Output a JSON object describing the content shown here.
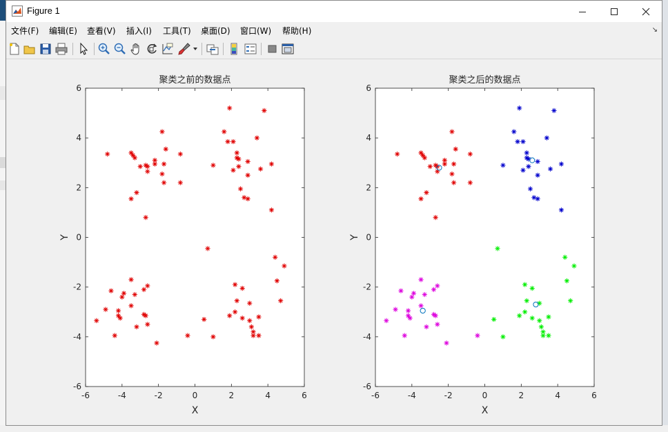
{
  "window": {
    "title": "Figure 1"
  },
  "menu": {
    "items": [
      "文件(F)",
      "编辑(E)",
      "查看(V)",
      "插入(I)",
      "工具(T)",
      "桌面(D)",
      "窗口(W)",
      "帮助(H)"
    ]
  },
  "toolbar": {
    "icons": [
      "new-figure-icon",
      "open-file-icon",
      "save-icon",
      "print-icon",
      "pointer-icon",
      "zoom-in-icon",
      "zoom-out-icon",
      "pan-icon",
      "rotate-3d-icon",
      "data-cursor-icon",
      "brush-icon",
      "link-plot-icon",
      "colorbar-icon",
      "legend-icon",
      "hide-plot-tools-icon",
      "show-plot-tools-icon"
    ]
  },
  "colors": {
    "red": "#e00000",
    "blue": "#0000cc",
    "magenta": "#dd00dd",
    "green": "#00ee00",
    "center": "#0072bd"
  },
  "chart_data": [
    {
      "type": "scatter",
      "title": "聚类之前的数据点",
      "xlabel": "X",
      "ylabel": "Y",
      "xlim": [
        -6,
        6
      ],
      "ylim": [
        -6,
        6
      ],
      "xticks": [
        -6,
        -4,
        -2,
        0,
        2,
        4,
        6
      ],
      "yticks": [
        -6,
        -4,
        -2,
        0,
        2,
        4,
        6
      ],
      "grid": false,
      "series": [
        {
          "marker": "asterisk",
          "color": "#e00000",
          "points": [
            [
              -4.8,
              3.35
            ],
            [
              -3.5,
              3.4
            ],
            [
              -3.3,
              3.2
            ],
            [
              -3.4,
              3.3
            ],
            [
              -3.0,
              2.85
            ],
            [
              -2.7,
              2.9
            ],
            [
              -2.6,
              2.85
            ],
            [
              -2.6,
              2.65
            ],
            [
              -2.2,
              2.95
            ],
            [
              -2.2,
              3.1
            ],
            [
              -1.8,
              2.55
            ],
            [
              -1.7,
              2.95
            ],
            [
              -1.7,
              2.2
            ],
            [
              -1.6,
              3.55
            ],
            [
              -1.8,
              4.25
            ],
            [
              -0.8,
              3.35
            ],
            [
              -0.8,
              2.2
            ],
            [
              -3.5,
              1.55
            ],
            [
              -3.2,
              1.8
            ],
            [
              -2.7,
              0.8
            ],
            [
              1.9,
              5.2
            ],
            [
              3.8,
              5.1
            ],
            [
              1.6,
              4.25
            ],
            [
              1.8,
              3.85
            ],
            [
              2.1,
              3.85
            ],
            [
              3.4,
              4.0
            ],
            [
              2.3,
              3.4
            ],
            [
              2.3,
              3.2
            ],
            [
              2.4,
              3.15
            ],
            [
              1.0,
              2.9
            ],
            [
              2.1,
              2.7
            ],
            [
              2.4,
              2.85
            ],
            [
              2.9,
              3.05
            ],
            [
              2.9,
              2.5
            ],
            [
              3.6,
              2.75
            ],
            [
              4.2,
              2.95
            ],
            [
              2.5,
              1.95
            ],
            [
              2.7,
              1.6
            ],
            [
              2.9,
              1.55
            ],
            [
              4.2,
              1.1
            ],
            [
              0.7,
              -0.45
            ],
            [
              4.4,
              -0.8
            ],
            [
              4.9,
              -1.15
            ],
            [
              4.5,
              -1.75
            ],
            [
              2.2,
              -1.9
            ],
            [
              2.6,
              -2.05
            ],
            [
              2.3,
              -2.55
            ],
            [
              3.0,
              -2.65
            ],
            [
              2.2,
              -3.0
            ],
            [
              1.9,
              -3.15
            ],
            [
              2.6,
              -3.25
            ],
            [
              3.0,
              -3.35
            ],
            [
              3.5,
              -3.2
            ],
            [
              3.1,
              -3.6
            ],
            [
              3.2,
              -3.8
            ],
            [
              3.2,
              -3.95
            ],
            [
              3.5,
              -3.95
            ],
            [
              4.7,
              -2.55
            ],
            [
              0.5,
              -3.3
            ],
            [
              1.0,
              -4.0
            ],
            [
              -3.5,
              -1.7
            ],
            [
              -4.6,
              -2.15
            ],
            [
              -3.9,
              -2.25
            ],
            [
              -3.3,
              -2.3
            ],
            [
              -2.8,
              -2.1
            ],
            [
              -2.6,
              -1.95
            ],
            [
              -4.0,
              -2.4
            ],
            [
              -3.5,
              -2.75
            ],
            [
              -4.2,
              -2.95
            ],
            [
              -4.2,
              -3.15
            ],
            [
              -4.1,
              -3.25
            ],
            [
              -2.8,
              -3.1
            ],
            [
              -2.7,
              -3.15
            ],
            [
              -2.6,
              -3.5
            ],
            [
              -3.2,
              -3.6
            ],
            [
              -4.9,
              -2.9
            ],
            [
              -5.4,
              -3.35
            ],
            [
              -4.4,
              -3.95
            ],
            [
              -2.1,
              -4.25
            ],
            [
              -0.4,
              -3.95
            ]
          ]
        }
      ]
    },
    {
      "type": "scatter",
      "title": "聚类之后的数据点",
      "xlabel": "X",
      "ylabel": "Y",
      "xlim": [
        -6,
        6
      ],
      "ylim": [
        -6,
        6
      ],
      "xticks": [
        -6,
        -4,
        -2,
        0,
        2,
        4,
        6
      ],
      "yticks": [
        -6,
        -4,
        -2,
        0,
        2,
        4,
        6
      ],
      "grid": false,
      "series": [
        {
          "marker": "asterisk",
          "color": "#e00000",
          "points": [
            [
              -4.8,
              3.35
            ],
            [
              -3.5,
              3.4
            ],
            [
              -3.3,
              3.2
            ],
            [
              -3.4,
              3.3
            ],
            [
              -3.0,
              2.85
            ],
            [
              -2.7,
              2.9
            ],
            [
              -2.6,
              2.85
            ],
            [
              -2.6,
              2.65
            ],
            [
              -2.2,
              2.95
            ],
            [
              -2.2,
              3.1
            ],
            [
              -1.8,
              2.55
            ],
            [
              -1.7,
              2.95
            ],
            [
              -1.7,
              2.2
            ],
            [
              -1.6,
              3.55
            ],
            [
              -1.8,
              4.25
            ],
            [
              -0.8,
              3.35
            ],
            [
              -0.8,
              2.2
            ],
            [
              -3.5,
              1.55
            ],
            [
              -3.2,
              1.8
            ],
            [
              -2.7,
              0.8
            ]
          ]
        },
        {
          "marker": "asterisk",
          "color": "#0000cc",
          "points": [
            [
              1.9,
              5.2
            ],
            [
              3.8,
              5.1
            ],
            [
              1.6,
              4.25
            ],
            [
              1.8,
              3.85
            ],
            [
              2.1,
              3.85
            ],
            [
              3.4,
              4.0
            ],
            [
              2.3,
              3.4
            ],
            [
              2.3,
              3.2
            ],
            [
              2.4,
              3.15
            ],
            [
              1.0,
              2.9
            ],
            [
              2.1,
              2.7
            ],
            [
              2.4,
              2.85
            ],
            [
              2.9,
              3.05
            ],
            [
              2.9,
              2.5
            ],
            [
              3.6,
              2.75
            ],
            [
              4.2,
              2.95
            ],
            [
              2.5,
              1.95
            ],
            [
              2.7,
              1.6
            ],
            [
              2.9,
              1.55
            ],
            [
              4.2,
              1.1
            ]
          ]
        },
        {
          "marker": "asterisk",
          "color": "#00ee00",
          "points": [
            [
              0.7,
              -0.45
            ],
            [
              4.4,
              -0.8
            ],
            [
              4.9,
              -1.15
            ],
            [
              4.5,
              -1.75
            ],
            [
              2.2,
              -1.9
            ],
            [
              2.6,
              -2.05
            ],
            [
              2.3,
              -2.55
            ],
            [
              3.0,
              -2.65
            ],
            [
              2.2,
              -3.0
            ],
            [
              1.9,
              -3.15
            ],
            [
              2.6,
              -3.25
            ],
            [
              3.0,
              -3.35
            ],
            [
              3.5,
              -3.2
            ],
            [
              3.1,
              -3.6
            ],
            [
              3.2,
              -3.8
            ],
            [
              3.2,
              -3.95
            ],
            [
              3.5,
              -3.95
            ],
            [
              4.7,
              -2.55
            ],
            [
              0.5,
              -3.3
            ],
            [
              1.0,
              -4.0
            ]
          ]
        },
        {
          "marker": "asterisk",
          "color": "#dd00dd",
          "points": [
            [
              -3.5,
              -1.7
            ],
            [
              -4.6,
              -2.15
            ],
            [
              -3.9,
              -2.25
            ],
            [
              -3.3,
              -2.3
            ],
            [
              -2.8,
              -2.1
            ],
            [
              -2.6,
              -1.95
            ],
            [
              -4.0,
              -2.4
            ],
            [
              -3.5,
              -2.75
            ],
            [
              -4.2,
              -2.95
            ],
            [
              -4.2,
              -3.15
            ],
            [
              -4.1,
              -3.25
            ],
            [
              -2.8,
              -3.1
            ],
            [
              -2.7,
              -3.15
            ],
            [
              -2.6,
              -3.5
            ],
            [
              -3.2,
              -3.6
            ],
            [
              -4.9,
              -2.9
            ],
            [
              -5.4,
              -3.35
            ],
            [
              -4.4,
              -3.95
            ],
            [
              -2.1,
              -4.25
            ],
            [
              -0.4,
              -3.95
            ]
          ]
        },
        {
          "marker": "circle",
          "color": "#0072bd",
          "points": [
            [
              -2.5,
              2.8
            ],
            [
              2.6,
              3.1
            ],
            [
              2.8,
              -2.7
            ],
            [
              -3.4,
              -2.95
            ]
          ]
        }
      ]
    }
  ]
}
